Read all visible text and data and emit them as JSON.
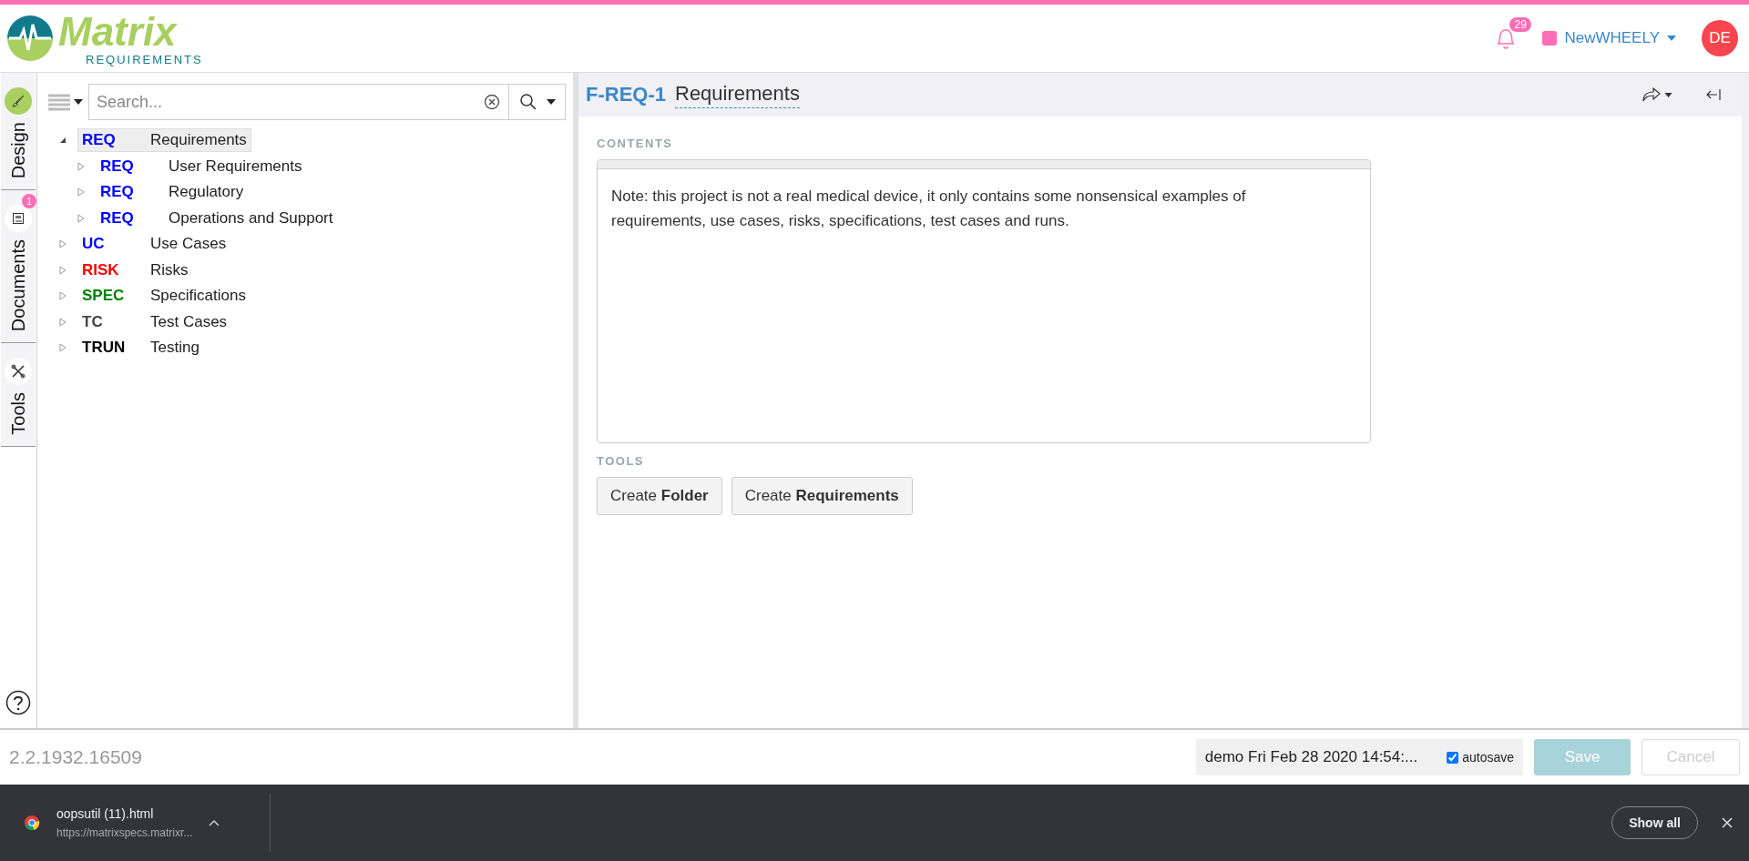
{
  "header": {
    "logo": {
      "name": "Matrix",
      "subtitle": "REQUIREMENTS"
    },
    "notifications": {
      "count": "29"
    },
    "project": {
      "name": "NewWHEELY",
      "color": "#ff6eb4"
    },
    "user": {
      "initials": "DE"
    }
  },
  "side_tabs": [
    {
      "label": "Design",
      "selected": true
    },
    {
      "label": "Documents",
      "selected": false,
      "badge": "1"
    },
    {
      "label": "Tools",
      "selected": false
    }
  ],
  "tree_toolbar": {
    "search": {
      "placeholder": "Search..."
    }
  },
  "tree": [
    {
      "prefix": "REQ",
      "color": "#0000ff",
      "label": "Requirements",
      "expanded": true,
      "selected": true,
      "children": [
        {
          "prefix": "REQ",
          "color": "#0000ff",
          "label": "User Requirements",
          "expanded": false,
          "selected": false
        },
        {
          "prefix": "REQ",
          "color": "#0000ff",
          "label": "Regulatory",
          "expanded": false,
          "selected": false
        },
        {
          "prefix": "REQ",
          "color": "#0000ff",
          "label": "Operations and Support",
          "expanded": false,
          "selected": false
        }
      ]
    },
    {
      "prefix": "UC",
      "color": "#0000ff",
      "label": "Use Cases",
      "expanded": false,
      "selected": false
    },
    {
      "prefix": "RISK",
      "color": "#ff0000",
      "label": "Risks",
      "expanded": false,
      "selected": false
    },
    {
      "prefix": "SPEC",
      "color": "#008000",
      "label": "Specifications",
      "expanded": false,
      "selected": false
    },
    {
      "prefix": "TC",
      "color": "#444444",
      "label": "Test Cases",
      "expanded": false,
      "selected": false
    },
    {
      "prefix": "TRUN",
      "color": "#000000",
      "label": "Testing",
      "expanded": false,
      "selected": false
    }
  ],
  "item": {
    "id": "F-REQ-1",
    "title": "Requirements",
    "contents_label": "CONTENTS",
    "contents": "Note: this project is not a real medical device, it only contains some nonsensical examples of requirements, use cases, risks, specifications, test cases and runs.",
    "tools_label": "TOOLS",
    "tool_buttons": [
      "Create **Folder**",
      "Create **Requirements**"
    ]
  },
  "status_bar": {
    "version": "2.2.1932.16509",
    "session": "demo Fri Feb 28 2020 14:54:...",
    "autosave": {
      "label": "autosave",
      "checked": true
    },
    "save": {
      "label": "Save",
      "disabled": true
    },
    "cancel": {
      "label": "Cancel",
      "disabled": true
    }
  },
  "download_bar": {
    "file": "oopsutil (11).html",
    "url": "https://matrixspecs.matrixr...",
    "show_all": "Show all"
  }
}
